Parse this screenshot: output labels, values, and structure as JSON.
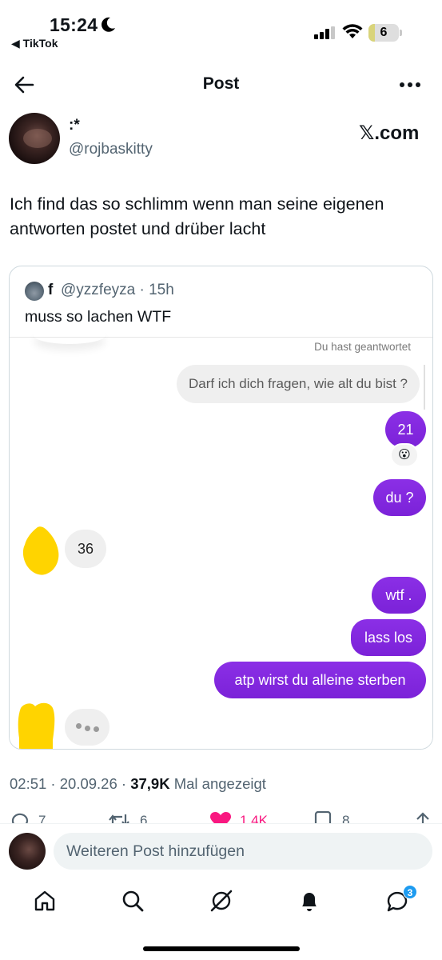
{
  "status_bar": {
    "time": "15:24",
    "back_app": "◀ TikTok",
    "battery_level": "6"
  },
  "header": {
    "title": "Post"
  },
  "author": {
    "name": ":*",
    "handle": "@rojbaskitty",
    "source": "𝕏.com"
  },
  "post": {
    "text": "Ich find das so schlimm wenn man seine eigenen antworten postet und drüber lacht"
  },
  "quoted": {
    "name": "f",
    "handle": "@yzzfeyza · 15h",
    "text": "muss so lachen WTF",
    "chat": {
      "replied_label": "Du hast geantwortet",
      "question": "Darf ich dich fragen,  wie alt du bist ?",
      "msg_21": "21",
      "reaction": "😮",
      "msg_du": "du ?",
      "msg_36": "36",
      "msg_wtf": "wtf .",
      "msg_lass": "lass los",
      "msg_atp": "atp wirst du alleine sterben"
    }
  },
  "meta": {
    "time_date": "02:51 · 20.09.26 · ",
    "views": "37,9K",
    "views_label": " Mal angezeigt"
  },
  "actions": {
    "replies": "7",
    "reposts": "6",
    "likes": "1,4K",
    "bookmarks": "8"
  },
  "reply_bar": {
    "placeholder": "Weiteren Post hinzufügen"
  },
  "nav": {
    "messages_badge": "3"
  },
  "colors": {
    "purple_bubble": "#8a2be2",
    "gray_bubble": "#efefef",
    "like_pink": "#f91880",
    "badge_blue": "#1d9bf0"
  }
}
